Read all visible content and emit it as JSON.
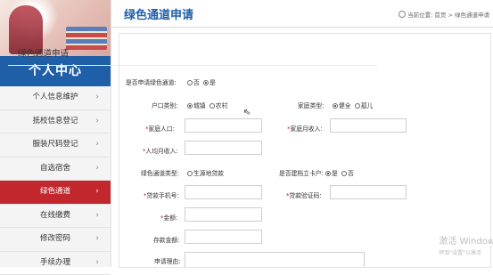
{
  "sidebar": {
    "header": "个人中心",
    "items": [
      {
        "label": "个人信息维护",
        "active": false
      },
      {
        "label": "抵校信息登记",
        "active": false
      },
      {
        "label": "服装尺码登记",
        "active": false
      },
      {
        "label": "自选宿舍",
        "active": false
      },
      {
        "label": "绿色通道",
        "active": true
      },
      {
        "label": "在线缴费",
        "active": false
      },
      {
        "label": "修改密码",
        "active": false
      },
      {
        "label": "手续办理",
        "active": false
      }
    ],
    "chevron": "›"
  },
  "page": {
    "title": "绿色通道申请",
    "breadcrumb": {
      "prefix": "当前位置:",
      "home": "首页",
      "sep": ">",
      "current": "绿色通道申请"
    }
  },
  "form": {
    "card_title": "绿色通道申请",
    "apply_label": "是否申请绿色通道:",
    "apply_options": [
      "否",
      "是"
    ],
    "apply_selected": "是",
    "hukou_label": "户口类别:",
    "hukou_options": [
      "城镇",
      "农村"
    ],
    "hukou_selected": "城镇",
    "family_type_label": "家庭类型:",
    "family_type_options": [
      "健全",
      "孤儿"
    ],
    "family_type_selected": "健全",
    "family_pop_label": "家庭人口:",
    "family_income_label": "家庭月收入:",
    "per_capita_label": "人均月收入:",
    "gc_type_label": "绿色通道类型:",
    "gc_type_options": [
      "生源地贷款"
    ],
    "gc_type_selected": "",
    "card_holder_label": "是否建档立卡户:",
    "card_holder_options": [
      "是",
      "否"
    ],
    "card_holder_selected": "是",
    "loan_phone_label": "贷款手机号:",
    "loan_code_label": "贷款验证码:",
    "amount_label": "金额:",
    "deposit_label": "存款金额:",
    "reason_label": "申请理由:",
    "required_mark": "*"
  },
  "watermark": {
    "line1": "激活 Window",
    "line2": "转到\"设置\"以激活"
  }
}
